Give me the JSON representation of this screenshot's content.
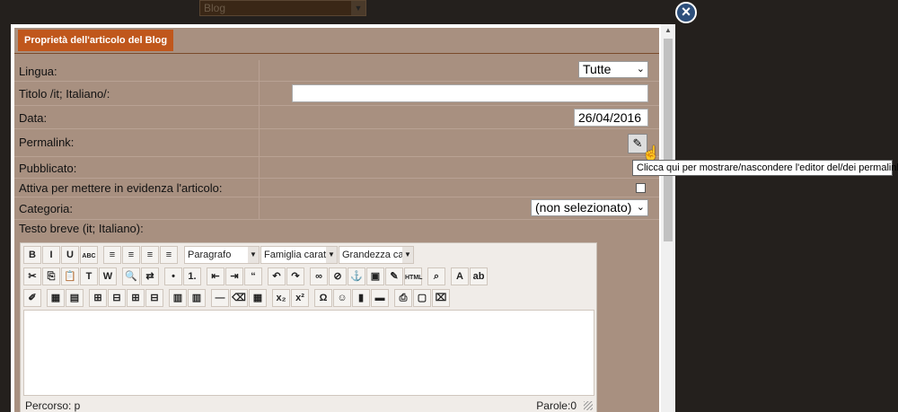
{
  "background": {
    "select_value": "Blog"
  },
  "close_label": "×",
  "panel": {
    "title": "Proprietà dell'articolo del Blog",
    "fields": {
      "lingua_label": "Lingua:",
      "lingua_value": "Tutte",
      "titolo_label": "Titolo /it; Italiano/:",
      "titolo_value": "",
      "data_label": "Data:",
      "data_value": "26/04/2016",
      "permalink_label": "Permalink:",
      "pubblicato_label": "Pubblicato:",
      "evidenza_label": "Attiva per mettere in evidenza l'articolo:",
      "categoria_label": "Categoria:",
      "categoria_value": "(non selezionato)",
      "testo_breve_label": "Testo breve (it; Italiano):"
    },
    "tooltip": "Clicca qui per mostrare/nascondere l'editor del/dei permalink"
  },
  "editor": {
    "format_dropdown": "Paragrafo",
    "font_dropdown": "Famiglia caratt",
    "size_dropdown": "Grandezza car",
    "status_path": "Percorso: p",
    "status_words": "Parole:0",
    "row1": [
      {
        "icon": "bold-icon",
        "glyph": "B"
      },
      {
        "icon": "italic-icon",
        "glyph": "I"
      },
      {
        "icon": "underline-icon",
        "glyph": "U"
      },
      {
        "icon": "strikethrough-icon",
        "glyph": "ABC"
      },
      {
        "icon": "align-left-icon",
        "glyph": "≡"
      },
      {
        "icon": "align-center-icon",
        "glyph": "≡"
      },
      {
        "icon": "align-right-icon",
        "glyph": "≡"
      },
      {
        "icon": "align-justify-icon",
        "glyph": "≡"
      }
    ],
    "row2": [
      {
        "icon": "cut-icon",
        "glyph": "✂"
      },
      {
        "icon": "copy-icon",
        "glyph": "⎘"
      },
      {
        "icon": "paste-icon",
        "glyph": "📋"
      },
      {
        "icon": "paste-text-icon",
        "glyph": "T"
      },
      {
        "icon": "paste-word-icon",
        "glyph": "W"
      },
      {
        "icon": "find-icon",
        "glyph": "🔍"
      },
      {
        "icon": "replace-icon",
        "glyph": "⇄"
      },
      {
        "icon": "bullet-list-icon",
        "glyph": "•"
      },
      {
        "icon": "numbered-list-icon",
        "glyph": "1."
      },
      {
        "icon": "outdent-icon",
        "glyph": "⇤"
      },
      {
        "icon": "indent-icon",
        "glyph": "⇥"
      },
      {
        "icon": "blockquote-icon",
        "glyph": "“"
      },
      {
        "icon": "undo-icon",
        "glyph": "↶"
      },
      {
        "icon": "redo-icon",
        "glyph": "↷"
      },
      {
        "icon": "link-icon",
        "glyph": "∞"
      },
      {
        "icon": "unlink-icon",
        "glyph": "⊘"
      },
      {
        "icon": "anchor-icon",
        "glyph": "⚓"
      },
      {
        "icon": "image-icon",
        "glyph": "▣"
      },
      {
        "icon": "cleanup-icon",
        "glyph": "✎"
      },
      {
        "icon": "html-icon",
        "glyph": "HTML"
      },
      {
        "icon": "preview-icon",
        "glyph": "⌕"
      },
      {
        "icon": "text-color-icon",
        "glyph": "A"
      },
      {
        "icon": "highlight-color-icon",
        "glyph": "ab"
      }
    ],
    "row3": [
      {
        "icon": "edit-icon",
        "glyph": "✐"
      },
      {
        "icon": "table-props-icon",
        "glyph": "▦"
      },
      {
        "icon": "table-row-icon",
        "glyph": "▤"
      },
      {
        "icon": "row-insert-icon",
        "glyph": "⊞"
      },
      {
        "icon": "row-delete-icon",
        "glyph": "⊟"
      },
      {
        "icon": "col-insert-icon",
        "glyph": "⊞"
      },
      {
        "icon": "col-delete-icon",
        "glyph": "⊟"
      },
      {
        "icon": "cell-split-icon",
        "glyph": "▥"
      },
      {
        "icon": "cell-merge-icon",
        "glyph": "▥"
      },
      {
        "icon": "horizontal-rule-icon",
        "glyph": "—"
      },
      {
        "icon": "remove-format-icon",
        "glyph": "⌫"
      },
      {
        "icon": "table-icon",
        "glyph": "▦"
      },
      {
        "icon": "subscript-icon",
        "glyph": "x₂"
      },
      {
        "icon": "superscript-icon",
        "glyph": "x²"
      },
      {
        "icon": "special-char-icon",
        "glyph": "Ω"
      },
      {
        "icon": "emoticon-icon",
        "glyph": "☺"
      },
      {
        "icon": "media-icon",
        "glyph": "▮"
      },
      {
        "icon": "advanced-hr-icon",
        "glyph": "▬"
      },
      {
        "icon": "print-icon",
        "glyph": "⎙"
      },
      {
        "icon": "fullscreen-icon",
        "glyph": "▢"
      },
      {
        "icon": "pdf-icon",
        "glyph": "⌧"
      }
    ]
  },
  "colors": {
    "panel_bg": "#a89080",
    "title_bg": "#c0571c",
    "page_bg": "#24201d",
    "close_bg": "#2d4f7b"
  }
}
